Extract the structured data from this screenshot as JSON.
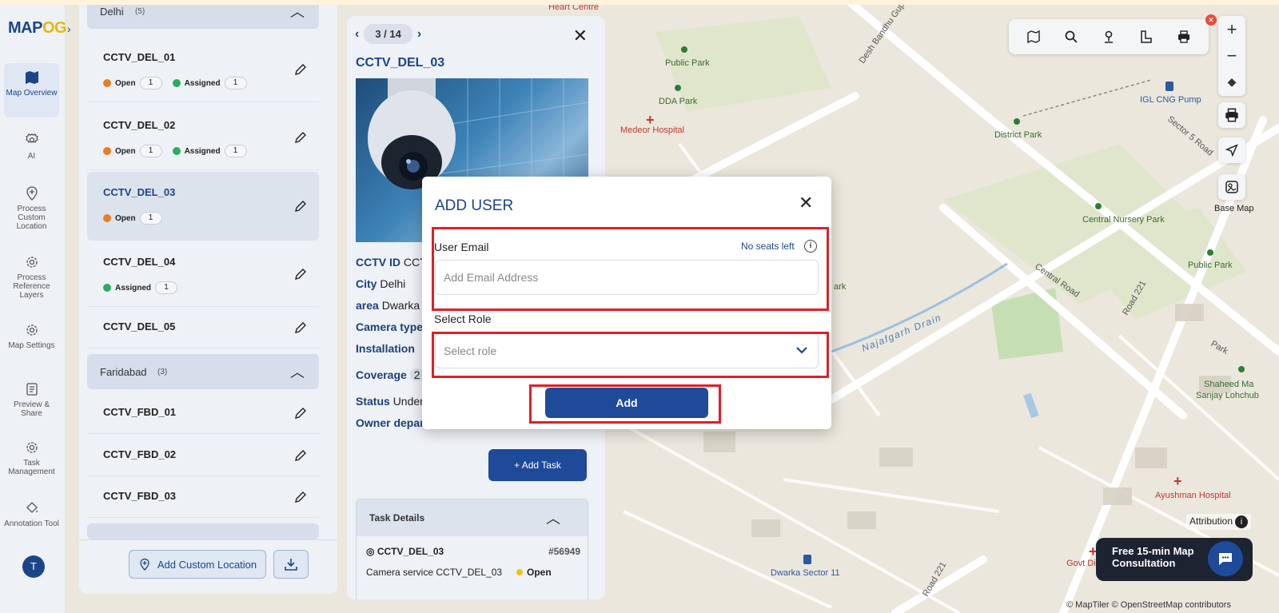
{
  "app": {
    "logo_text_a": "MAP",
    "logo_text_b": "OG",
    "avatar_initial": "T"
  },
  "rail": [
    {
      "label": "Map Overview",
      "icon": "map-icon"
    },
    {
      "label": "AI",
      "icon": "gear-icon"
    },
    {
      "label": "Process Custom Location",
      "icon": "location-plus-icon"
    },
    {
      "label": "Process Reference Layers",
      "icon": "gear-icon"
    },
    {
      "label": "Map Settings",
      "icon": "gear-icon"
    },
    {
      "label": "Preview & Share",
      "icon": "share-icon"
    },
    {
      "label": "Task Management",
      "icon": "gear-icon"
    },
    {
      "label": "Annotation Tool",
      "icon": "paint-bucket-icon"
    }
  ],
  "list": {
    "group1": {
      "name": "Delhi",
      "count": "(5)"
    },
    "group2": {
      "name": "Faridabad",
      "count": "(3)"
    },
    "open_label": "Open",
    "assigned_label": "Assigned",
    "items": [
      {
        "name": "CCTV_DEL_01",
        "open": "1",
        "assigned": "1"
      },
      {
        "name": "CCTV_DEL_02",
        "open": "1",
        "assigned": "1"
      },
      {
        "name": "CCTV_DEL_03",
        "open": "1"
      },
      {
        "name": "CCTV_DEL_04",
        "assigned": "1"
      },
      {
        "name": "CCTV_DEL_05"
      },
      {
        "name": "CCTV_FBD_01"
      },
      {
        "name": "CCTV_FBD_02"
      },
      {
        "name": "CCTV_FBD_03"
      }
    ],
    "add_location_label": "Add Custom Location"
  },
  "detail": {
    "pager": "3 / 14",
    "title": "CCTV_DEL_03",
    "attrs": [
      {
        "k": "CCTV ID",
        "v": "CCT"
      },
      {
        "k": "City",
        "v": "Delhi"
      },
      {
        "k": "area",
        "v": "Dwarka"
      },
      {
        "k": "Camera type",
        "v": ""
      },
      {
        "k": "Installation",
        "v": ""
      },
      {
        "k": "Coverage",
        "v": "2"
      },
      {
        "k": "Status",
        "v": "Under"
      },
      {
        "k": "Owner depar",
        "v": ""
      }
    ],
    "add_task_label": "+ Add Task",
    "task_details_label": "Task Details",
    "task_location": "CCTV_DEL_03",
    "task_id": "#56949",
    "task_title": "Camera service CCTV_DEL_03",
    "task_status": "Open"
  },
  "map_labels": [
    "Heart Centre",
    "Public Park",
    "DDA Park",
    "Medeor Hospital",
    "Desh Bandhu Gupta",
    "IGL CNG Pump",
    "Sector 5 Road",
    "District Park",
    "Central Nursery Park",
    "Central Road",
    "Public Park",
    "Road 221",
    "Najafgarh Drain",
    "Park",
    "Shaheed Ma",
    "Sanjay Lohchub",
    "Ayushman Hospital",
    "Govt Disp",
    "Dwarka Sector 11",
    "Road 221",
    "ark"
  ],
  "map_ui": {
    "basemap_label": "Base Map",
    "attribution_label": "Attribution",
    "copyright": "© MapTiler © OpenStreetMap contributors",
    "consult_line1": "Free 15-min Map",
    "consult_line2": "Consultation",
    "zoom_in": "+",
    "zoom_out": "−"
  },
  "modal": {
    "title": "ADD USER",
    "email_label": "User Email",
    "seats_text": "No seats left",
    "email_value": "",
    "email_placeholder": "Add Email Address",
    "role_label": "Select Role",
    "role_placeholder": "Select role",
    "add_label": "Add"
  },
  "colors": {
    "brand": "#1c4587",
    "accent": "#1f4a9a",
    "highlight": "#e01f26",
    "open": "#e67e22",
    "assigned": "#27ae60"
  }
}
